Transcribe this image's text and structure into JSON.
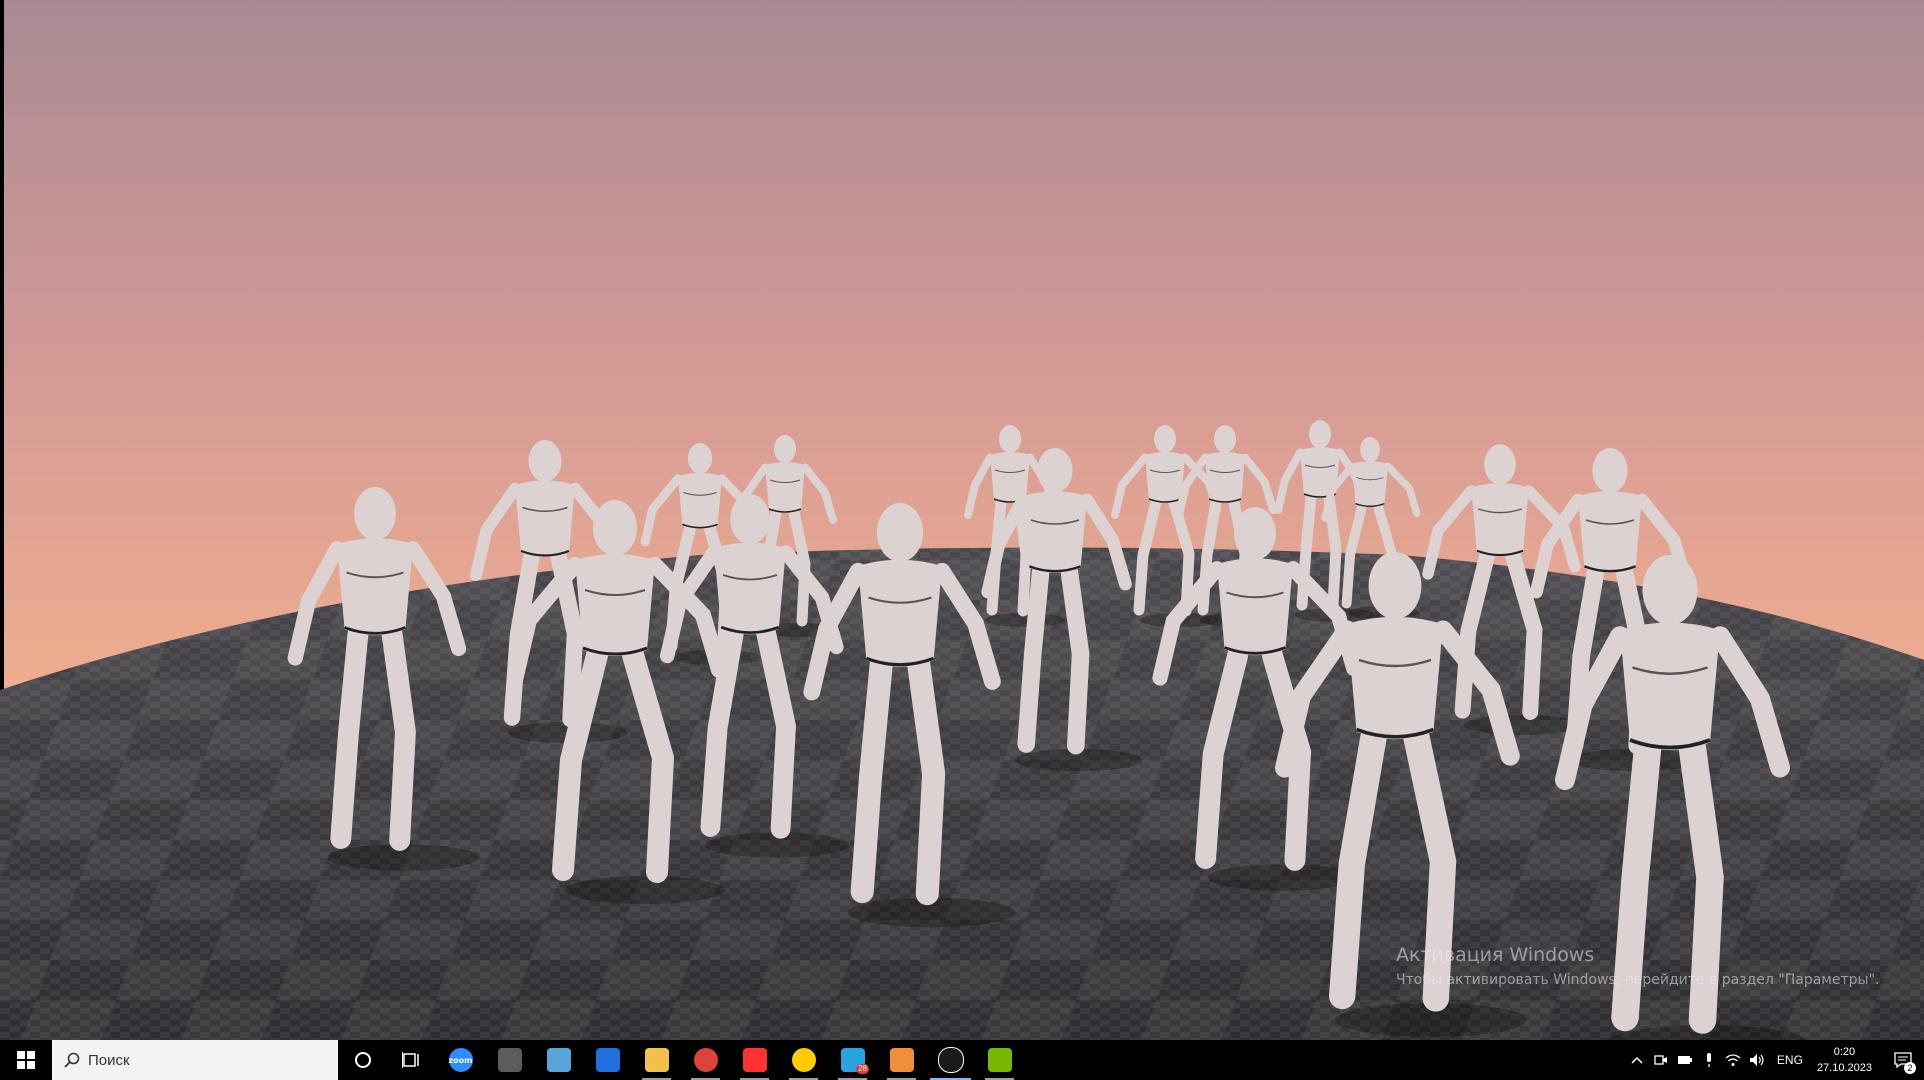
{
  "watermark": {
    "title": "Активация Windows",
    "subtitle": "Чтобы активировать Windows, перейдите в раздел \"Параметры\"."
  },
  "taskbar": {
    "search_placeholder": "Поиск",
    "pinned_apps": [
      {
        "name": "zoom",
        "label": "zoom",
        "color": "#2d8cff"
      },
      {
        "name": "krita",
        "color": "#5c5c5c"
      },
      {
        "name": "notes-app",
        "color": "#57a6d8"
      },
      {
        "name": "calculator-grid",
        "color": "#1f6fdc"
      },
      {
        "name": "file-explorer",
        "color": "#f3c04c"
      },
      {
        "name": "chrome",
        "color": "#db4437"
      },
      {
        "name": "yandex-browser",
        "color": "#ff3333"
      },
      {
        "name": "yandex-music",
        "color": "#ffcc00"
      },
      {
        "name": "telegram",
        "color": "#2aa3df",
        "badge": "28"
      },
      {
        "name": "sublime-app",
        "color": "#f18e3a"
      },
      {
        "name": "unreal-engine",
        "color": "#1a1a1a"
      },
      {
        "name": "nvidia",
        "color": "#76b900"
      }
    ],
    "tray": {
      "language": "ENG",
      "time": "0:20",
      "date": "27.10.2023",
      "notifications_count": "2"
    }
  },
  "colors": {
    "sky_top": "#a98a94",
    "sky_bottom": "#f2b08e",
    "floor": "#3a393f",
    "figure": "#ddd2d2",
    "taskbar": "#000000"
  }
}
